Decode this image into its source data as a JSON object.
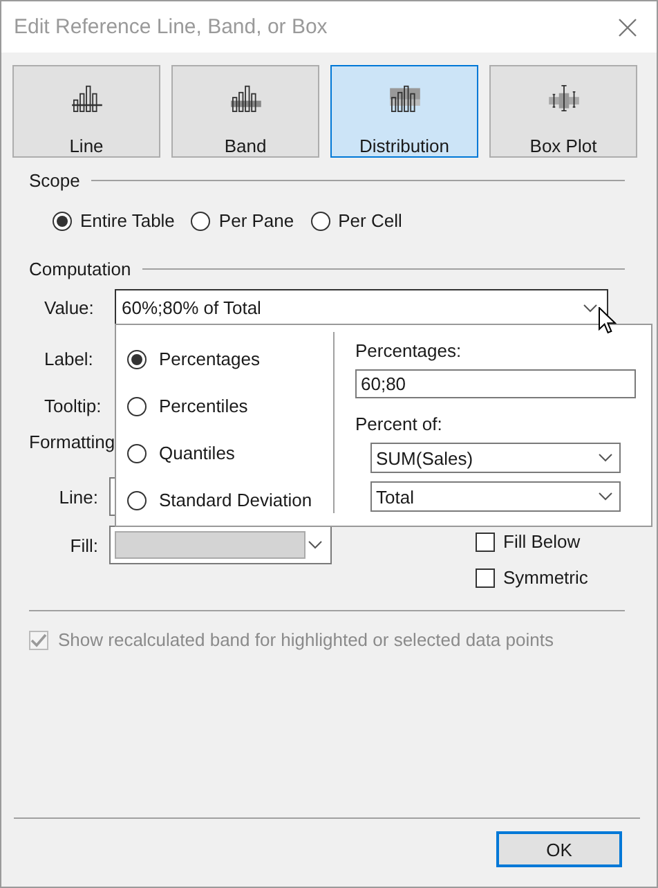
{
  "window": {
    "title": "Edit Reference Line, Band, or Box"
  },
  "types": [
    {
      "label": "Line",
      "kind": "line",
      "selected": false
    },
    {
      "label": "Band",
      "kind": "band",
      "selected": false
    },
    {
      "label": "Distribution",
      "kind": "distribution",
      "selected": true
    },
    {
      "label": "Box Plot",
      "kind": "boxplot",
      "selected": false
    }
  ],
  "scope": {
    "title": "Scope",
    "options": [
      {
        "label": "Entire Table",
        "selected": true
      },
      {
        "label": "Per Pane",
        "selected": false
      },
      {
        "label": "Per Cell",
        "selected": false
      }
    ]
  },
  "computation": {
    "title": "Computation",
    "value_label": "Value:",
    "value": "60%;80% of Total",
    "label_label": "Label:",
    "tooltip_label": "Tooltip:"
  },
  "popup": {
    "methods": [
      {
        "label": "Percentages",
        "selected": true
      },
      {
        "label": "Percentiles",
        "selected": false
      },
      {
        "label": "Quantiles",
        "selected": false
      },
      {
        "label": "Standard Deviation",
        "selected": false
      }
    ],
    "percentages_label": "Percentages:",
    "percentages_value": "60;80",
    "percent_of_label": "Percent of:",
    "measure": "SUM(Sales)",
    "aggregation": "Total"
  },
  "formatting": {
    "title": "Formatting",
    "line_label": "Line:",
    "fill_label": "Fill:",
    "options": [
      {
        "label": "Fill Below",
        "checked": false
      },
      {
        "label": "Symmetric",
        "checked": false
      }
    ]
  },
  "recalc": {
    "label": "Show recalculated band for highlighted or selected data points",
    "checked": true,
    "disabled": true
  },
  "buttons": [
    "OK"
  ]
}
